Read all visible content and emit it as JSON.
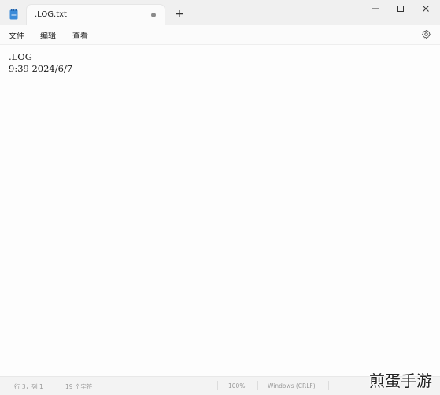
{
  "tab": {
    "title": ".LOG.txt",
    "new_tab": "+"
  },
  "window": {
    "minimize": "minimize",
    "maximize": "maximize",
    "close": "close"
  },
  "menu": {
    "file": "文件",
    "edit": "编辑",
    "view": "查看"
  },
  "icons": {
    "app": "notepad-icon",
    "settings": "gear-icon",
    "unsaved": "unsaved-dot-icon"
  },
  "document": {
    "lines": [
      ".LOG",
      "9:39 2024/6/7"
    ]
  },
  "status": {
    "position": "行 3，列 1",
    "chars": "19 个字符",
    "zoom": "100%",
    "line_ending": "Windows (CRLF)"
  },
  "watermark": "煎蛋手游"
}
